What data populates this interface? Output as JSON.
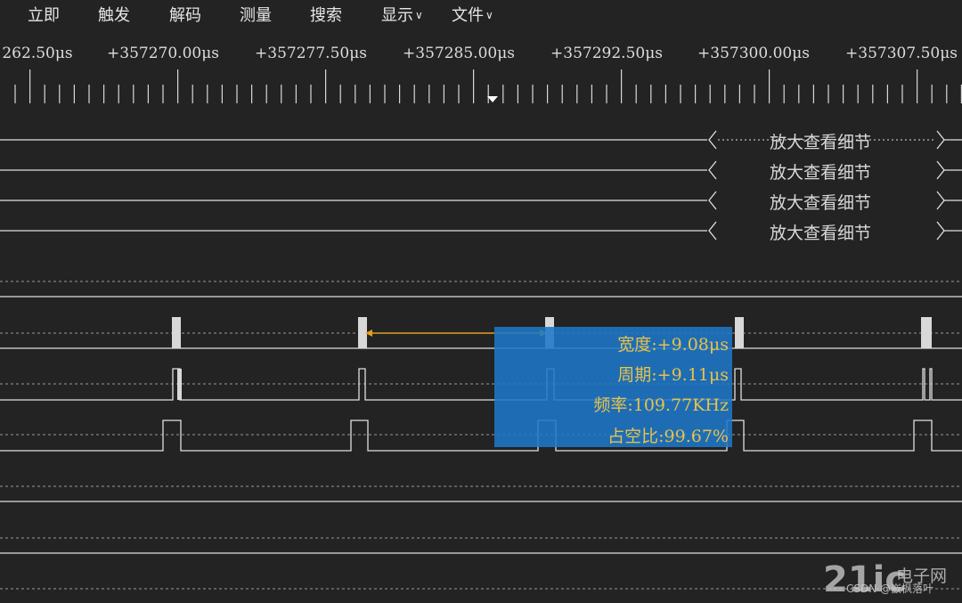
{
  "menu": {
    "items": [
      {
        "label": "立即",
        "has_dropdown": false
      },
      {
        "label": "触发",
        "has_dropdown": false
      },
      {
        "label": "解码",
        "has_dropdown": false
      },
      {
        "label": "测量",
        "has_dropdown": false
      },
      {
        "label": "搜索",
        "has_dropdown": false
      },
      {
        "label": "显示",
        "has_dropdown": true
      },
      {
        "label": "文件",
        "has_dropdown": true
      }
    ],
    "dropdown_icon": "chevron-down-icon"
  },
  "timeline": {
    "labels": [
      "262.50μs",
      "+357270.00μs",
      "+357277.50μs",
      "+357285.00μs",
      "+357292.50μs",
      "+357300.00μs",
      "+357307.50μs"
    ],
    "trigger_marker_icon": "trigger-marker-icon"
  },
  "zoom_hint": {
    "label": "放大查看细节",
    "count": 4
  },
  "measurement": {
    "width": "宽度:+9.08μs",
    "period": "周期:+9.11μs",
    "frequency": "频率:109.77KHz",
    "duty_cycle": "占空比:99.67%"
  },
  "watermark": {
    "logo": "21ic",
    "site": "电子网",
    "credit": "CSDN @嵌枫落叶"
  },
  "colors": {
    "background": "#232323",
    "trace": "#e0e0e0",
    "measure_box": "#1e78c8",
    "measure_text": "#e8c24a",
    "cursor": "#e0a020"
  }
}
